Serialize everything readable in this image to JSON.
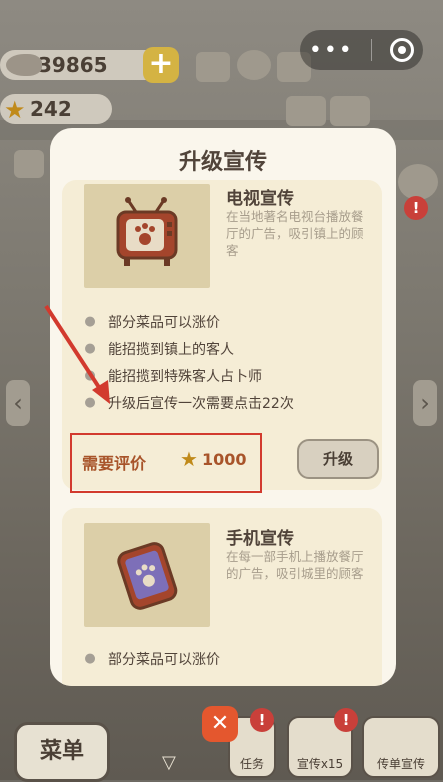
{
  "hud": {
    "coins": "39865",
    "stars": "242"
  },
  "modal": {
    "title": "升级宣传"
  },
  "promotions": [
    {
      "title": "电视宣传",
      "description": "在当地著名电视台播放餐厅的广告，吸引镇上的顾客",
      "perks": [
        "部分菜品可以涨价",
        "能招揽到镇上的客人",
        "能招揽到特殊客人占卜师",
        "升级后宣传一次需要点击22次"
      ],
      "requirement_label": "需要评价",
      "requirement_value": "1000",
      "button_label": "升级"
    },
    {
      "title": "手机宣传",
      "description": "在每一部手机上播放餐厅的广告，吸引城里的顾客",
      "perks": [
        "部分菜品可以涨价"
      ]
    }
  ],
  "bottom_bar": {
    "menu_label": "菜单",
    "task_label": "任务",
    "promote_label": "宣传x15",
    "flyer_label": "传单宣传",
    "close_symbol": "✕"
  },
  "icons": {
    "alert": "!",
    "paw": "🐾",
    "star": "★"
  },
  "colors": {
    "modal_bg": "#faf6ec",
    "card_bg": "#f5edd6",
    "highlight_red": "#d23a2e",
    "requirement_text": "#a8542a"
  }
}
